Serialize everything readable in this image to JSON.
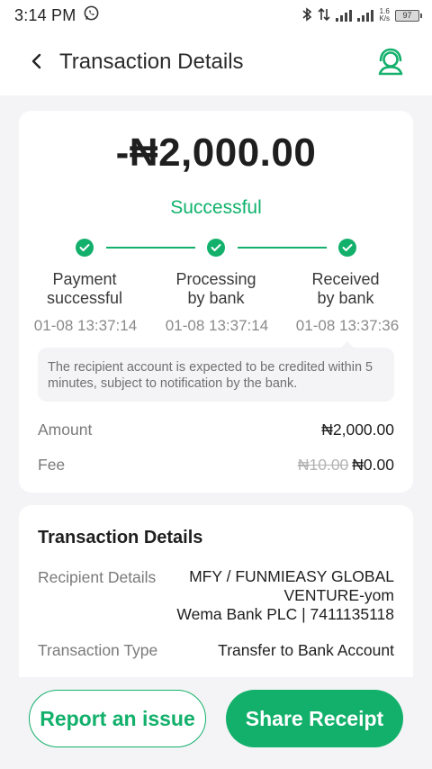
{
  "status_bar": {
    "time": "3:14 PM",
    "net_speed": "1.6",
    "net_unit": "K/s",
    "battery": "97",
    "net_type": "E"
  },
  "header": {
    "title": "Transaction Details"
  },
  "summary": {
    "amount": "-₦2,000.00",
    "status": "Successful",
    "steps": [
      {
        "label_line1": "Payment",
        "label_line2": "successful",
        "time": "01-08 13:37:14"
      },
      {
        "label_line1": "Processing",
        "label_line2": "by bank",
        "time": "01-08 13:37:14"
      },
      {
        "label_line1": "Received",
        "label_line2": "by bank",
        "time": "01-08 13:37:36"
      }
    ],
    "notice": "The recipient account is expected to be credited within 5 minutes, subject to notification by the bank.",
    "amount_label": "Amount",
    "amount_value": "₦2,000.00",
    "fee_label": "Fee",
    "fee_original": "₦10.00",
    "fee_value": "₦0.00"
  },
  "details": {
    "title": "Transaction Details",
    "recipient_label": "Recipient Details",
    "recipient_line1": "MFY / FUNMIEASY GLOBAL",
    "recipient_line2": "VENTURE-yom",
    "recipient_line3": "Wema Bank PLC | 7411135118",
    "type_label": "Transaction Type",
    "type_value": "Transfer to Bank Account"
  },
  "actions": {
    "report_label": "Report an issue",
    "share_label": "Share Receipt"
  },
  "colors": {
    "accent": "#12b06b",
    "background": "#f4f4f6"
  }
}
